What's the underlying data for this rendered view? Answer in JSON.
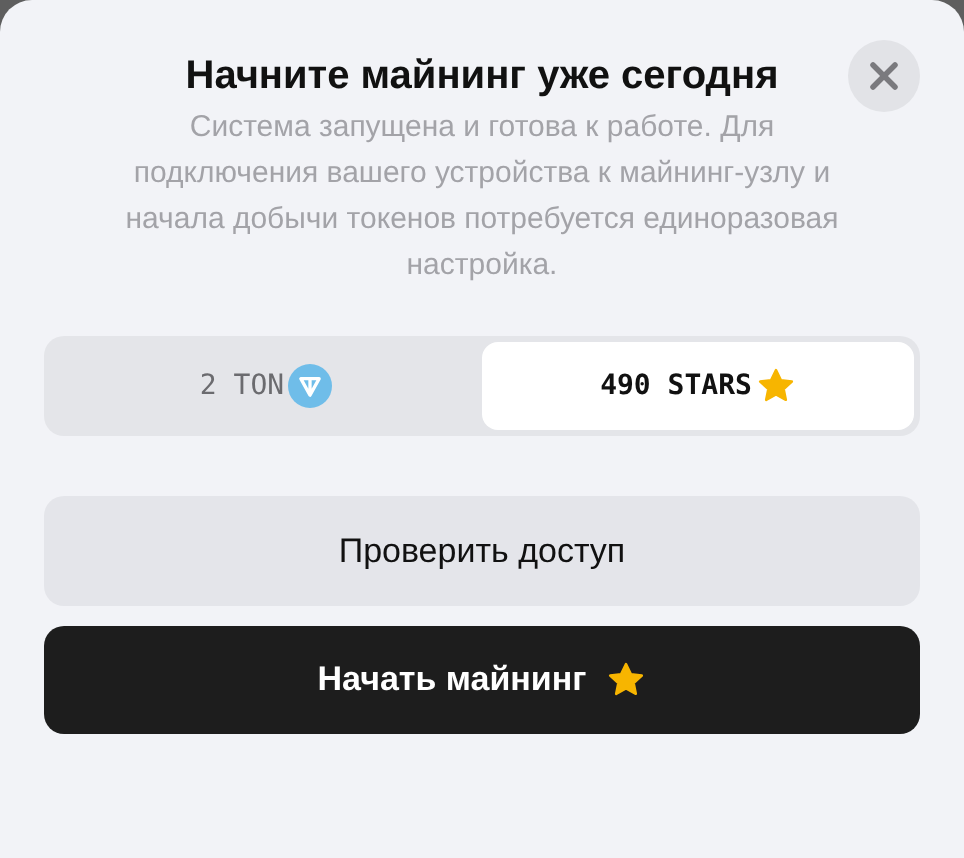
{
  "dialog": {
    "title": "Начните майнинг уже сегодня",
    "description": "Система запущена и готова к работе. Для подключения вашего устройства к майнинг-узлу и начала добычи токенов потребуется единоразовая настройка.",
    "payment_options": [
      {
        "label": "2 TON",
        "kind": "ton",
        "selected": false
      },
      {
        "label": "490 STARS",
        "kind": "stars",
        "selected": true
      }
    ],
    "buttons": [
      {
        "label": "Проверить доступ",
        "kind": "secondary"
      },
      {
        "label": "Начать майнинг",
        "kind": "primary"
      }
    ]
  }
}
